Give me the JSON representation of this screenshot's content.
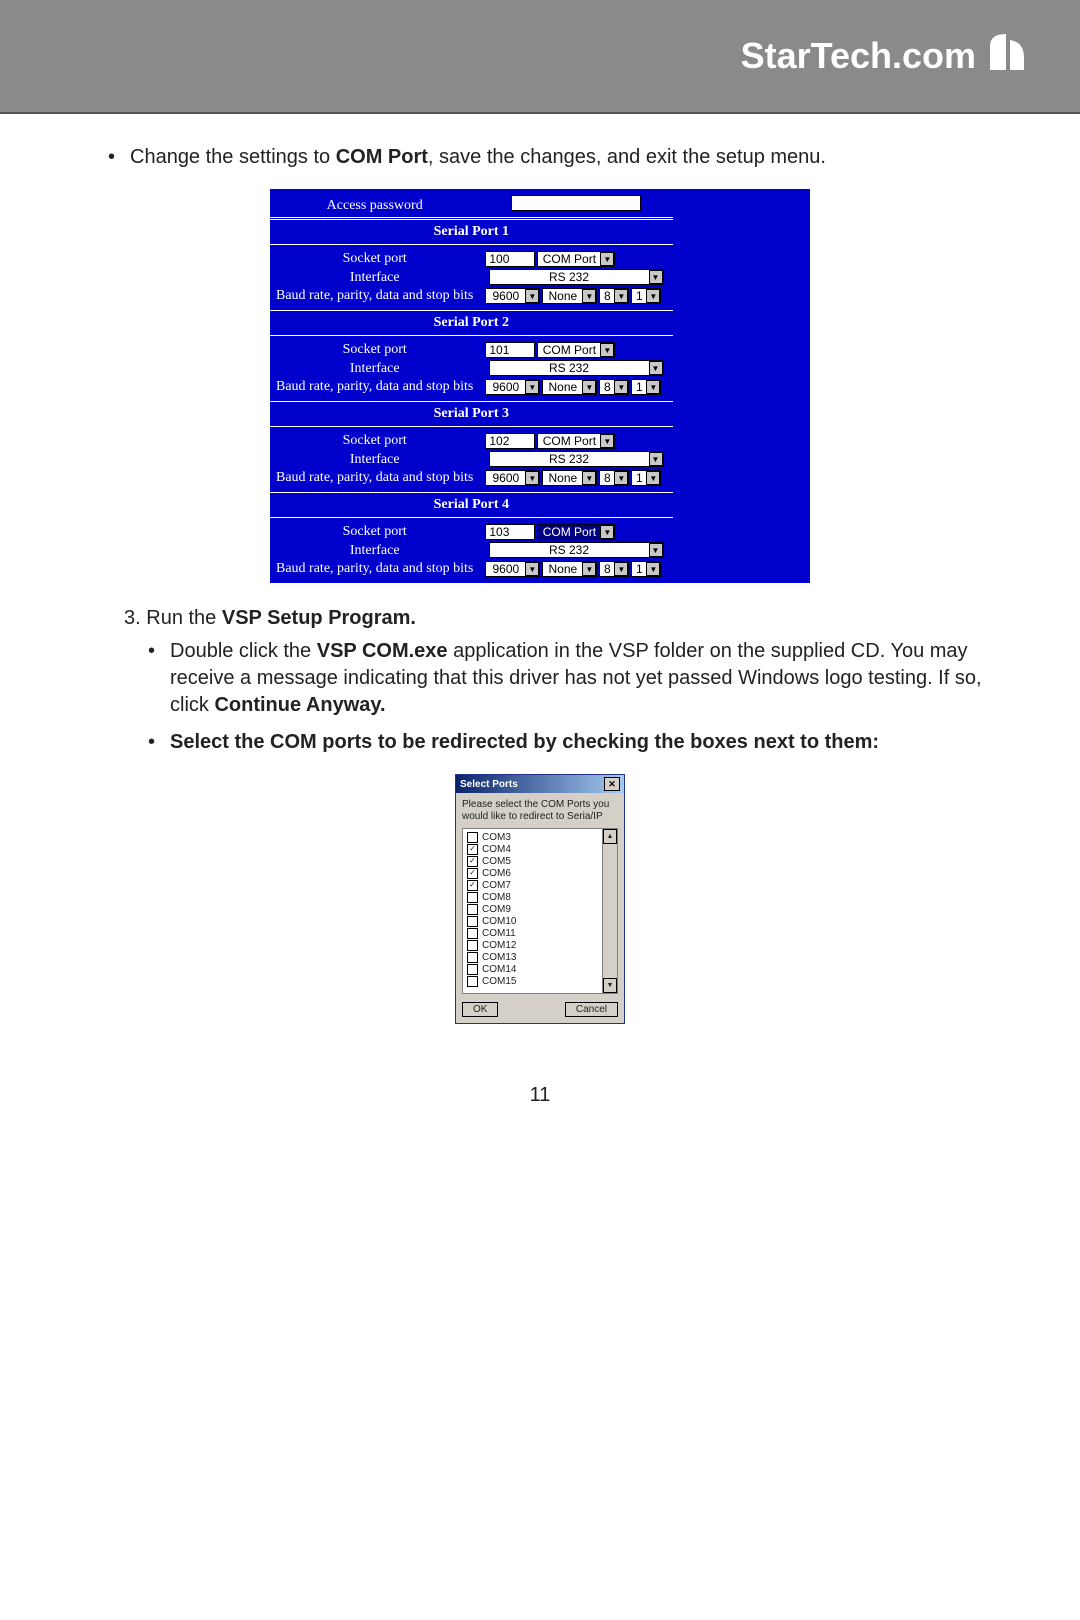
{
  "brand": "StarTech.com",
  "page_number": "11",
  "bullet1": {
    "pre": "Change the settings to ",
    "bold": "COM Port",
    "post": ", save the changes, and exit the setup menu."
  },
  "config": {
    "access_password_label": "Access password",
    "section_prefix": "Serial Port ",
    "labels": {
      "socket": "Socket port",
      "interface": "Interface",
      "baud": "Baud rate, parity, data and stop bits"
    },
    "ports": [
      {
        "n": "1",
        "socket": "100",
        "mode": "COM Port",
        "iface": "RS 232",
        "baud": "9600",
        "parity": "None",
        "data": "8",
        "stop": "1",
        "highlight": false
      },
      {
        "n": "2",
        "socket": "101",
        "mode": "COM Port",
        "iface": "RS 232",
        "baud": "9600",
        "parity": "None",
        "data": "8",
        "stop": "1",
        "highlight": false
      },
      {
        "n": "3",
        "socket": "102",
        "mode": "COM Port",
        "iface": "RS 232",
        "baud": "9600",
        "parity": "None",
        "data": "8",
        "stop": "1",
        "highlight": false
      },
      {
        "n": "4",
        "socket": "103",
        "mode": "COM Port",
        "iface": "RS 232",
        "baud": "9600",
        "parity": "None",
        "data": "8",
        "stop": "1",
        "highlight": true
      }
    ]
  },
  "step3": {
    "number": "3.",
    "pre": "Run the ",
    "bold": "VSP Setup Program."
  },
  "sub_bullet_a": {
    "pre": "Double click the ",
    "bold1": "VSP COM.exe",
    "mid": " application in the VSP folder on the supplied CD. You may receive a message indicating that this driver has not yet passed Windows logo testing. If so, click ",
    "bold2": "Continue Anyway."
  },
  "sub_bullet_b": "Select the COM ports to be redirected by checking the boxes next to them:",
  "dialog": {
    "title": "Select Ports",
    "instruction": "Please select the COM Ports you would like to redirect to Seria/IP",
    "ports": [
      {
        "label": "COM3",
        "checked": false
      },
      {
        "label": "COM4",
        "checked": true
      },
      {
        "label": "COM5",
        "checked": true
      },
      {
        "label": "COM6",
        "checked": true
      },
      {
        "label": "COM7",
        "checked": true
      },
      {
        "label": "COM8",
        "checked": false
      },
      {
        "label": "COM9",
        "checked": false
      },
      {
        "label": "COM10",
        "checked": false
      },
      {
        "label": "COM11",
        "checked": false
      },
      {
        "label": "COM12",
        "checked": false
      },
      {
        "label": "COM13",
        "checked": false
      },
      {
        "label": "COM14",
        "checked": false
      },
      {
        "label": "COM15",
        "checked": false
      }
    ],
    "ok": "OK",
    "cancel": "Cancel"
  }
}
